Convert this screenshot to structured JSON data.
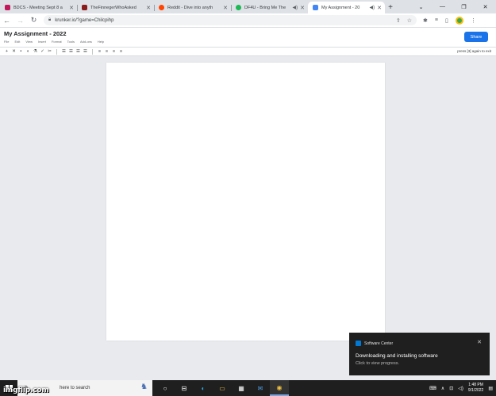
{
  "browser": {
    "tabs": [
      {
        "title": "BDCS - Meeting Sept 8 a",
        "favicon_color": "#c2185b",
        "active": false
      },
      {
        "title": "TheFinnegerWhoAsked",
        "favicon_color": "#8b1a1a",
        "active": false
      },
      {
        "title": "Reddit - Dive into anyth",
        "favicon_color": "#ff4500",
        "active": false
      },
      {
        "title": "DF4U - Bring Me The",
        "favicon_color": "#1db954",
        "active": false,
        "audio": "◀)"
      },
      {
        "title": "My Assignment - 20",
        "favicon_color": "#4285f4",
        "active": true,
        "audio": "◀)"
      }
    ],
    "new_tab": "+",
    "window_controls": {
      "minimize": "⌄",
      "restore": "—",
      "maximize": "❐",
      "close": "✕"
    },
    "nav": {
      "back": "←",
      "forward": "→",
      "reload": "↻"
    },
    "url": "krunker.io/?game=Chilcpihp",
    "accent": "#1a73e8"
  },
  "doc": {
    "title": "My Assignment - 2022",
    "menus": [
      "File",
      "Edit",
      "View",
      "Insert",
      "Format",
      "Tools",
      "Add-ons",
      "Help"
    ],
    "share_label": "Share",
    "format_tools": [
      "+",
      "✕",
      "▪",
      "◐",
      "⚗",
      "✓",
      "✂"
    ],
    "format_tools2": [
      "☰",
      "☰",
      "☰",
      "☰"
    ],
    "format_tools3": [
      "≡",
      "≡",
      "≡",
      "≡"
    ],
    "exit_hint": "press [3] again to exit"
  },
  "toast": {
    "app": "Software Center",
    "title": "Downloading and installing software",
    "body": "Click to view progress."
  },
  "taskbar": {
    "search_placeholder": "here to search",
    "apps": [
      "○",
      "⊟",
      "◐",
      "▭",
      "▦",
      "✉",
      "◉"
    ],
    "tray": [
      "⌨",
      "∧",
      "⊡",
      "◁)"
    ],
    "time": "1:48 PM",
    "date": "9/1/2022",
    "notification_icon": "▤"
  },
  "watermark": "imgflip.com"
}
